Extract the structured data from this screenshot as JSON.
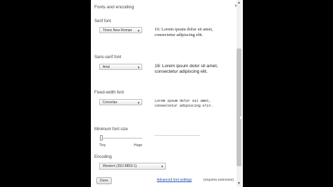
{
  "dialog": {
    "title": "Fonts and encoding",
    "close_icon": "×"
  },
  "serif": {
    "label": "Serif font",
    "selected": "Times New Roman",
    "sample_line1": "16: Lorem ipsum dolor sit amet,",
    "sample_line2": "consectetur adipiscing elit."
  },
  "sans": {
    "label": "Sans-serif font",
    "selected": "Arial",
    "sample_line1": "16: Lorem ipsum dolor sit amet,",
    "sample_line2": "consectetur adipiscing elit."
  },
  "fixed": {
    "label": "Fixed-width font",
    "selected": "Consolas",
    "sample_line1": "Lorem ipsum dolor sit amet,",
    "sample_line2": "consectetur adipiscing elit."
  },
  "minsize": {
    "label": "Minimum font size",
    "tiny_label": "Tiny",
    "huge_label": "Huge"
  },
  "encoding": {
    "label": "Encoding",
    "selected": "Western (ISO-8859-1)"
  },
  "footer": {
    "done_label": "Done",
    "advanced_link": "Advanced font settings",
    "advanced_note": "(requires extension)"
  },
  "icons": {
    "dropdown": "▾",
    "scroll_up": "▲",
    "scroll_down": "▼"
  }
}
